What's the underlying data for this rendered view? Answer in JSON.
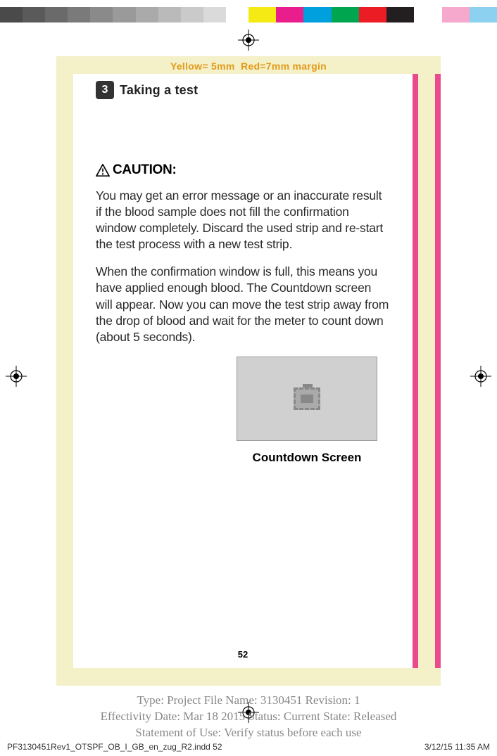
{
  "colorbar": {
    "grays": [
      "#4a4a4a",
      "#5a5a5a",
      "#6a6a6a",
      "#7a7a7a",
      "#8a8a8a",
      "#9a9a9a",
      "#aaaaaa",
      "#bababa",
      "#cacaca",
      "#dadada",
      "#ffffff"
    ],
    "colors": [
      "#f5ea14",
      "#e91e8c",
      "#00a0df",
      "#00a550",
      "#ec1c24",
      "#231f20",
      "#ffffff",
      "#f7a8cd",
      "#8cd2f0"
    ]
  },
  "margin_note": "Yellow= 5mm  Red=7mm margin",
  "section": {
    "number": "3",
    "title": "Taking a test"
  },
  "caution_label": "CAUTION:",
  "para1": "You may get an error message or an inaccurate result if the blood sample does not fill the confirmation window completely. Discard the used strip and re-start the test process with a new test strip.",
  "para2": "When the confirmation window is full, this means you have applied enough blood. The Countdown screen will appear. Now you can move the test strip away from the drop of blood and wait for the meter to count down (about 5 seconds).",
  "screen_caption": "Countdown Screen",
  "page_number": "52",
  "meta": {
    "line1": "Type: Project File  Name: 3130451  Revision: 1",
    "line2": "Effectivity Date: Mar 18 2015     Status: Current     State: Released",
    "line3": "Statement of Use: Verify status before each use"
  },
  "footer": {
    "file": "PF3130451Rev1_OTSPF_OB_I_GB_en_zug_R2.indd   52",
    "date": "3/12/15   11:35 AM"
  }
}
